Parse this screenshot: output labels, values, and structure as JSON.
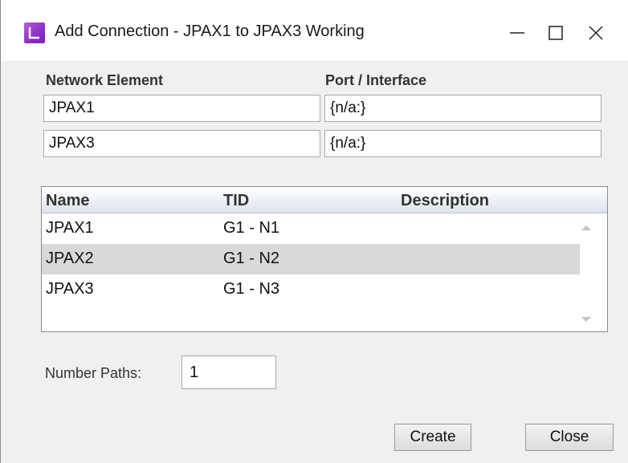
{
  "window": {
    "title": "Add Connection - JPAX1 to JPAX3 Working"
  },
  "icons": {
    "app": "app-icon",
    "minimize": "minimize-icon",
    "maximize": "maximize-icon",
    "close": "close-icon"
  },
  "endpoints": {
    "network_element_header": "Network Element",
    "port_header": "Port / Interface",
    "rows": [
      {
        "network_element": "JPAX1",
        "port": "{n/a:}"
      },
      {
        "network_element": "JPAX3",
        "port": "{n/a:}"
      }
    ]
  },
  "table": {
    "columns": [
      "Name",
      "TID",
      "Description"
    ],
    "rows": [
      {
        "name": "JPAX1",
        "tid": "G1 - N1",
        "description": "",
        "selected": false
      },
      {
        "name": "JPAX2",
        "tid": "G1 - N2",
        "description": "",
        "selected": true
      },
      {
        "name": "JPAX3",
        "tid": "G1 - N3",
        "description": "",
        "selected": false
      }
    ]
  },
  "number_paths": {
    "label": "Number Paths:",
    "value": "1"
  },
  "buttons": {
    "create": "Create",
    "close": "Close"
  },
  "colors": {
    "selected_row": "#d9d9d9",
    "app_icon": "#9b3fd0"
  }
}
